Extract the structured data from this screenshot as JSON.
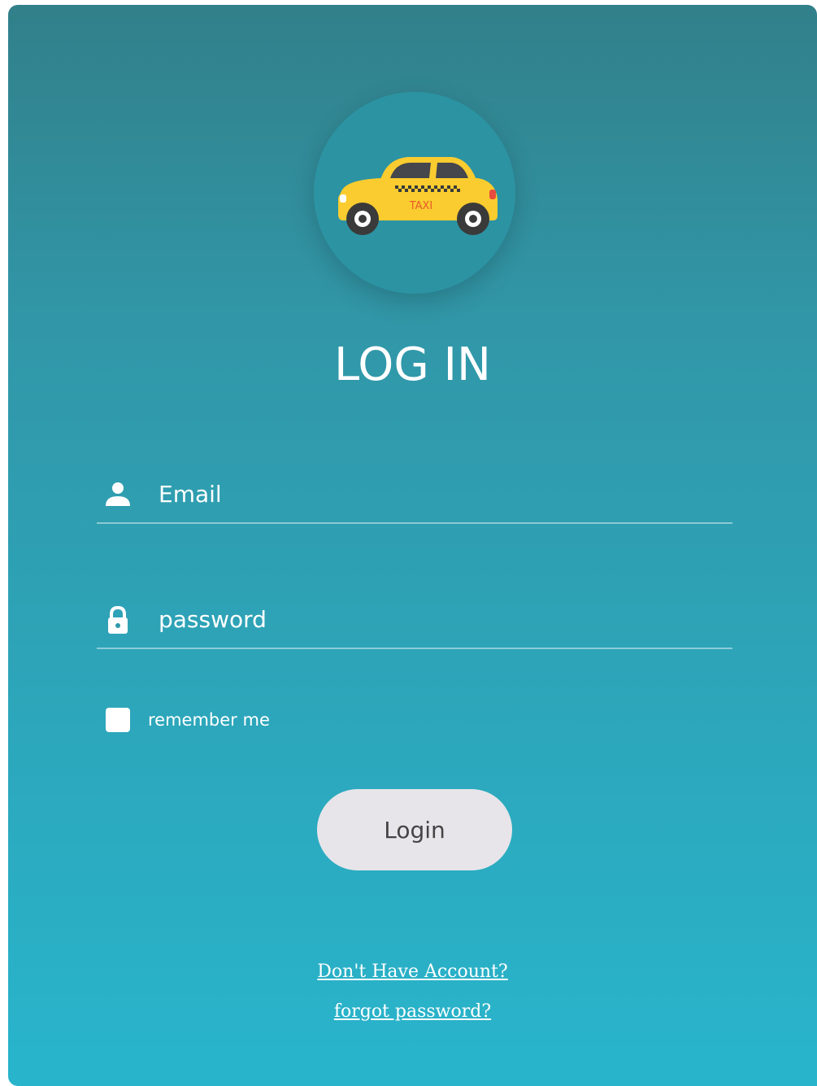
{
  "form": {
    "title": "LOG IN",
    "email_placeholder": "Email",
    "password_placeholder": "password",
    "remember_label": "remember me",
    "remember_checked": false,
    "login_label": "Login",
    "signup_link": "Don't Have Account?",
    "forgot_link": "forgot password?"
  },
  "logo": {
    "text": "TAXI",
    "icon": "taxi-car-icon"
  },
  "icons": {
    "email": "user-icon",
    "password": "lock-icon"
  },
  "colors": {
    "gradient_top": "#31808a",
    "gradient_bottom": "#28b5cc",
    "button_bg": "#e7e5ea",
    "taxi_yellow": "#fbcc2f"
  }
}
